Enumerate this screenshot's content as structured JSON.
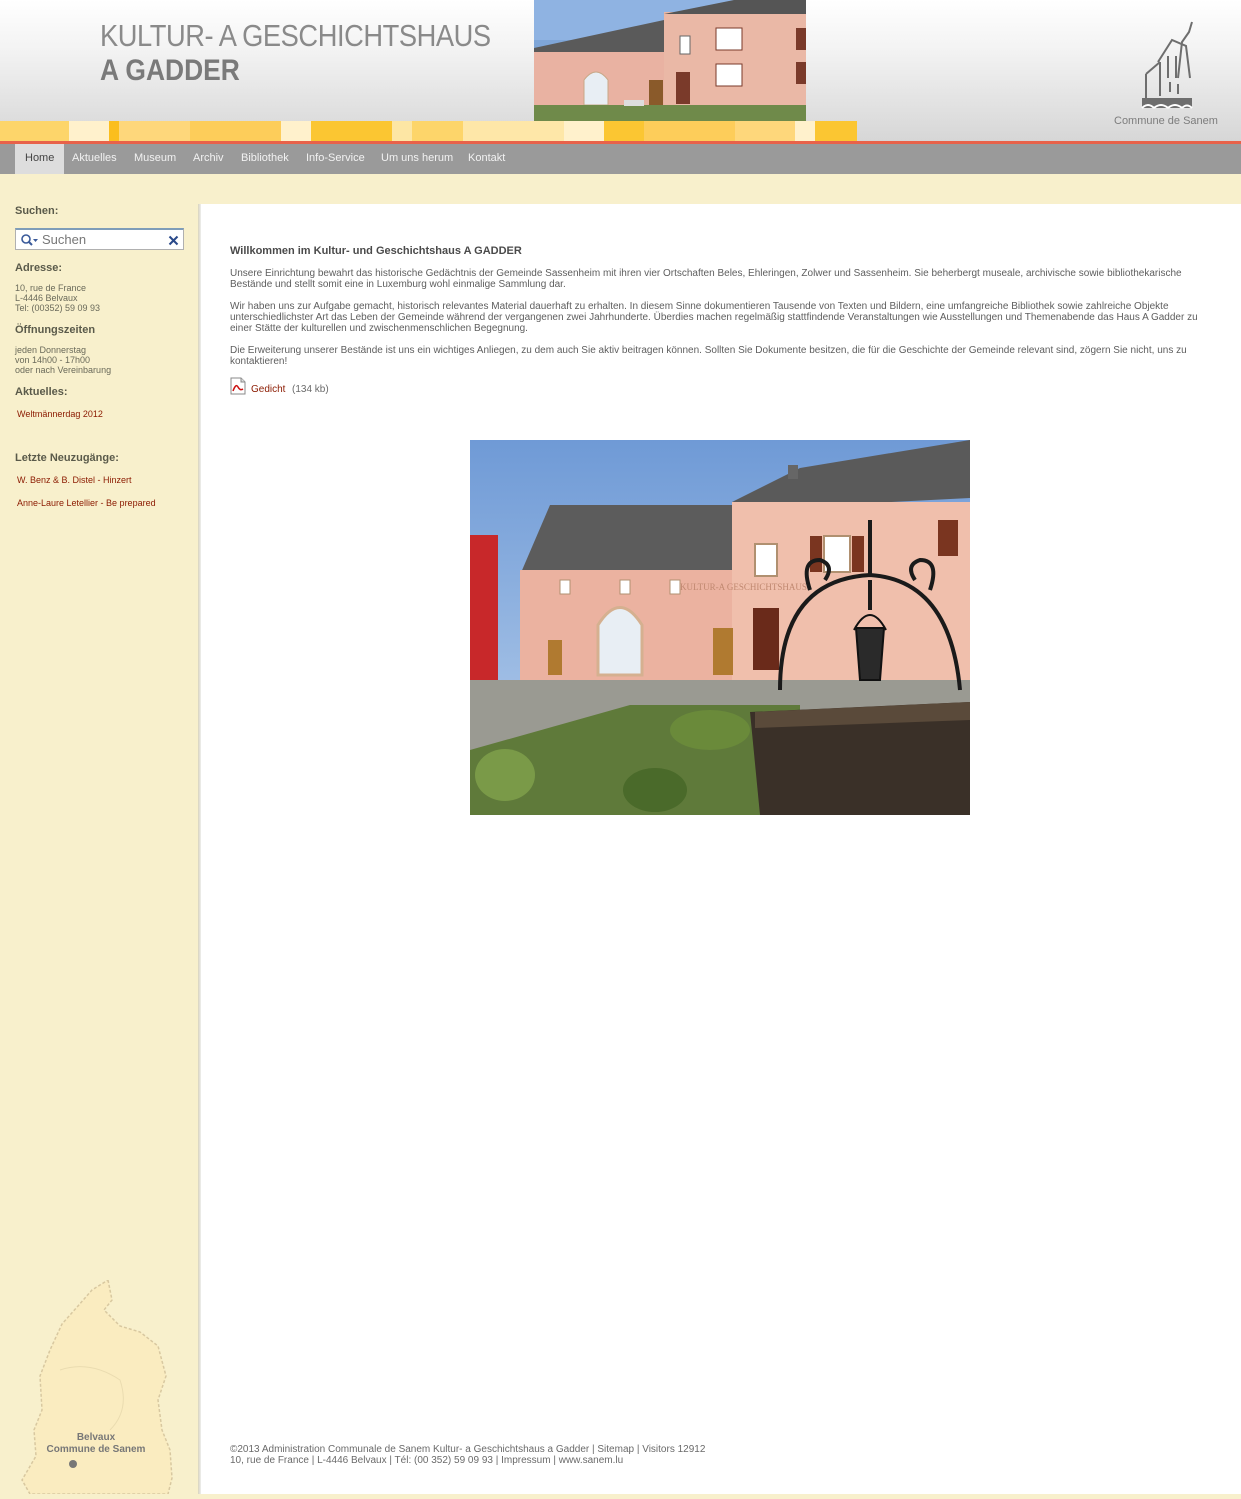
{
  "header": {
    "title_line1": "KULTUR- A GESCHICHTSHAUS",
    "title_line2": "A GADDER",
    "logo_text": "Commune de Sanem"
  },
  "nav": {
    "items": [
      {
        "label": "Home",
        "active": true
      },
      {
        "label": "Aktuelles",
        "active": false
      },
      {
        "label": "Museum",
        "active": false
      },
      {
        "label": "Archiv",
        "active": false
      },
      {
        "label": "Bibliothek",
        "active": false
      },
      {
        "label": "Info-Service",
        "active": false
      },
      {
        "label": "Um uns herum",
        "active": false
      },
      {
        "label": "Kontakt",
        "active": false
      }
    ]
  },
  "sidebar": {
    "search_heading": "Suchen:",
    "search_placeholder": "Suchen",
    "address_heading": "Adresse:",
    "address_line1": "10, rue de France",
    "address_line2": "L-4446 Belvaux",
    "address_line3": "Tel: (00352) 59 09 93",
    "hours_heading": "Öffnungszeiten",
    "hours_line1": "jeden Donnerstag",
    "hours_line2": "von 14h00 - 17h00",
    "hours_line3": "oder nach Vereinbarung",
    "news_heading": "Aktuelles:",
    "news_items": [
      "Weltmännerdag 2012"
    ],
    "new_heading": "Letzte Neuzugänge:",
    "new_items": [
      "W. Benz & B. Distel - Hinzert",
      "Anne-Laure Letellier - Be prepared"
    ],
    "map_label1": "Belvaux",
    "map_label2": "Commune de Sanem"
  },
  "content": {
    "welcome": "Willkommen im Kultur- und Geschichtshaus A GADDER",
    "paragraph1": "Unsere Einrichtung bewahrt das historische Gedächtnis der Gemeinde Sassenheim mit ihren vier Ortschaften Beles, Ehleringen, Zolwer und Sassenheim. Sie beherbergt museale, archivische sowie bibliothekarische Bestände und stellt somit eine in Luxemburg wohl einmalige Sammlung dar.",
    "paragraph2": "Wir haben uns zur Aufgabe gemacht, historisch relevantes Material dauerhaft zu erhalten. In diesem Sinne dokumentieren Tausende von Texten und Bildern, eine umfangreiche Bibliothek sowie zahlreiche Objekte unterschiedlichster Art das Leben der Gemeinde während der vergangenen zwei Jahrhunderte. Überdies machen regelmäßig stattfindende Veranstaltungen wie Ausstellungen und Themenabende das Haus A Gadder zu einer Stätte der kulturellen und zwischenmenschlichen Begegnung.",
    "paragraph3": "Die Erweiterung unserer Bestände ist uns ein wichtiges Anliegen, zu dem auch Sie aktiv beitragen können. Sollten Sie Dokumente besitzen, die für die Geschichte der Gemeinde relevant sind, zögern Sie nicht, uns zu kontaktieren!",
    "pdf_link": "Gedicht",
    "pdf_size": "(134 kb)"
  },
  "footer": {
    "line1": "©2013 Administration Communale de Sanem Kultur- a Geschichtshaus a Gadder | Sitemap | Visitors 12912",
    "line2": "10, rue de France | L-4446 Belvaux | Tél: (00 352) 59 09 93 | Impressum | www.sanem.lu"
  },
  "colors": {
    "accent_red": "#e8624a",
    "link_red": "#8b1a00",
    "sidebar_bg": "#f8f0cc",
    "nav_bg": "#9a9a9a"
  }
}
